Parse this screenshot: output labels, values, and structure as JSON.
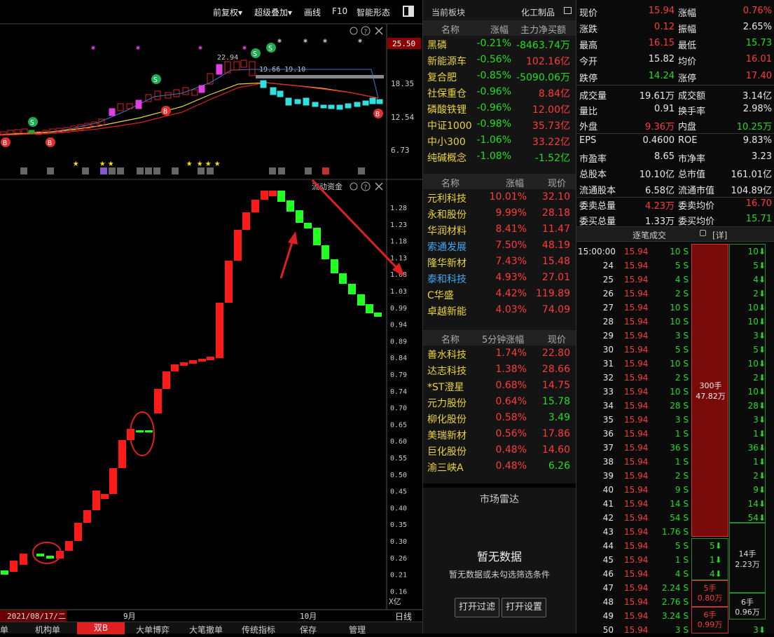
{
  "toolbar": {
    "items": [
      "前复权▾",
      "超级叠加▾",
      "画线",
      "F10",
      "智能形态"
    ]
  },
  "kline": {
    "price_badge": "25.50",
    "y_ticks": [
      "18.35",
      "12.54",
      "6.73"
    ],
    "annotation_high": "22.94",
    "annotation_range": "19.66-19.10"
  },
  "flow": {
    "title": "流动资金",
    "y_ticks": [
      "1.28",
      "1.23",
      "1.18",
      "1.13",
      "1.08",
      "1.03",
      "0.99",
      "0.94",
      "0.89",
      "0.84",
      "0.79",
      "0.74",
      "0.70",
      "0.65",
      "0.60",
      "0.55",
      "0.50",
      "0.45",
      "0.40",
      "0.35",
      "0.30",
      "0.26",
      "0.21",
      "0.16"
    ],
    "unit": "X亿"
  },
  "x_axis": {
    "date": "2021/08/17/二",
    "m1": "9月",
    "m2": "10月",
    "right": "日线"
  },
  "bottom_tabs": [
    "单",
    "机构单",
    "双B",
    "大单博弈",
    "大笔撤单",
    "传统指标",
    "保存",
    "管理"
  ],
  "sector": {
    "header_left": "当前板块",
    "header_right": "化工制品",
    "cols": [
      "名称",
      "涨幅",
      "主力净买额"
    ],
    "rows": [
      {
        "name": "黑磷",
        "pct": "-0.21%",
        "val": "-8463.74万"
      },
      {
        "name": "新能源车",
        "pct": "-0.56%",
        "val": "102.16亿"
      },
      {
        "name": "复合肥",
        "pct": "-0.85%",
        "val": "-5090.06万"
      },
      {
        "name": "社保重仓",
        "pct": "-0.96%",
        "val": "8.84亿"
      },
      {
        "name": "磷酸铁锂",
        "pct": "-0.96%",
        "val": "12.00亿"
      },
      {
        "name": "中证1000",
        "pct": "-0.98%",
        "val": "35.73亿"
      },
      {
        "name": "中小300",
        "pct": "-1.06%",
        "val": "33.22亿"
      },
      {
        "name": "纯碱概念",
        "pct": "-1.08%",
        "val": "-1.52亿"
      }
    ]
  },
  "related": {
    "cols": [
      "名称",
      "涨幅",
      "现价"
    ],
    "rows": [
      {
        "name": "元利科技",
        "pct": "10.01%",
        "price": "32.10"
      },
      {
        "name": "永和股份",
        "pct": "9.99%",
        "price": "28.18"
      },
      {
        "name": "华润材料",
        "pct": "8.41%",
        "price": "11.47"
      },
      {
        "name": "索通发展",
        "pct": "7.50%",
        "price": "48.19"
      },
      {
        "name": "隆华新材",
        "pct": "7.43%",
        "price": "15.48"
      },
      {
        "name": "泰和科技",
        "pct": "4.93%",
        "price": "27.01"
      },
      {
        "name": "C华盛",
        "pct": "4.42%",
        "price": "119.89"
      },
      {
        "name": "卓越新能",
        "pct": "4.03%",
        "price": "74.09"
      }
    ]
  },
  "speed": {
    "cols": [
      "名称",
      "5分钟涨幅",
      "现价"
    ],
    "rows": [
      {
        "name": "善水科技",
        "pct": "1.74%",
        "price": "22.80"
      },
      {
        "name": "达志科技",
        "pct": "1.38%",
        "price": "28.66"
      },
      {
        "name": "*ST澄星",
        "pct": "0.68%",
        "price": "14.75"
      },
      {
        "name": "元力股份",
        "pct": "0.64%",
        "price": "15.78"
      },
      {
        "name": "柳化股份",
        "pct": "0.58%",
        "price": "3.49"
      },
      {
        "name": "美瑞新材",
        "pct": "0.56%",
        "price": "17.86"
      },
      {
        "name": "巨化股份",
        "pct": "0.48%",
        "price": "14.60"
      },
      {
        "name": "渝三峡A",
        "pct": "0.48%",
        "price": "6.26"
      }
    ]
  },
  "radar": {
    "title": "市场雷达",
    "empty": "暂无数据",
    "hint": "暂无数据或未勾选筛选条件",
    "btn_filter": "打开过滤",
    "btn_settings": "打开设置"
  },
  "quote": {
    "rows": [
      [
        "现价",
        "15.94",
        "涨幅",
        "0.76%"
      ],
      [
        "涨跌",
        "0.12",
        "振幅",
        "2.65%"
      ],
      [
        "最高",
        "16.15",
        "最低",
        "15.73"
      ],
      [
        "今开",
        "15.82",
        "均价",
        "16.01"
      ],
      [
        "跌停",
        "14.24",
        "涨停",
        "17.40"
      ],
      [
        "成交量",
        "19.61万",
        "成交额",
        "3.14亿"
      ],
      [
        "量比",
        "0.91",
        "换手率",
        "2.98%"
      ],
      [
        "外盘",
        "9.36万",
        "内盘",
        "10.25万"
      ],
      [
        "EPS",
        "0.4600",
        "ROE",
        "9.83%"
      ],
      [
        "市盈率",
        "8.65",
        "市净率",
        "3.23"
      ],
      [
        "总股本",
        "10.10亿",
        "总市值",
        "161.01亿"
      ],
      [
        "流通股本",
        "6.58亿",
        "流通市值",
        "104.89亿"
      ],
      [
        "委卖总量",
        "4.23万",
        "委卖均价",
        "16.70"
      ],
      [
        "委买总量",
        "1.33万",
        "委买均价",
        "15.71"
      ]
    ]
  },
  "ticks": {
    "title": "逐笔成交",
    "detail": "[详]",
    "first_time": "15:00:00",
    "rows": [
      {
        "t": "",
        "p": "15.94",
        "v": "10 S",
        "r": "10"
      },
      {
        "t": "24",
        "p": "15.94",
        "v": "5 S",
        "r": "5"
      },
      {
        "t": "25",
        "p": "15.94",
        "v": "4 S",
        "r": "4"
      },
      {
        "t": "26",
        "p": "15.94",
        "v": "2 S",
        "r": "2"
      },
      {
        "t": "27",
        "p": "15.94",
        "v": "10 S",
        "r": "10"
      },
      {
        "t": "28",
        "p": "15.94",
        "v": "10 S",
        "r": "10"
      },
      {
        "t": "29",
        "p": "15.94",
        "v": "3 S",
        "r": "3"
      },
      {
        "t": "30",
        "p": "15.94",
        "v": "5 S",
        "r": "5"
      },
      {
        "t": "31",
        "p": "15.94",
        "v": "10 S",
        "r": "10"
      },
      {
        "t": "32",
        "p": "15.94",
        "v": "2 S",
        "r": "2"
      },
      {
        "t": "33",
        "p": "15.94",
        "v": "10 S",
        "r": "10"
      },
      {
        "t": "34",
        "p": "15.94",
        "v": "28 S",
        "r": "28"
      },
      {
        "t": "35",
        "p": "15.94",
        "v": "3 S",
        "r": "3"
      },
      {
        "t": "36",
        "p": "15.94",
        "v": "1 S",
        "r": "1"
      },
      {
        "t": "37",
        "p": "15.94",
        "v": "36 S",
        "r": "36"
      },
      {
        "t": "38",
        "p": "15.94",
        "v": "1 S",
        "r": "1"
      },
      {
        "t": "39",
        "p": "15.94",
        "v": "2 S",
        "r": "2"
      },
      {
        "t": "40",
        "p": "15.94",
        "v": "9 S",
        "r": "9"
      },
      {
        "t": "41",
        "p": "15.94",
        "v": "14 S",
        "r": "14"
      },
      {
        "t": "42",
        "p": "15.94",
        "v": "54 S",
        "r": "54"
      },
      {
        "t": "43",
        "p": "15.94",
        "v": "1.76 S",
        "r": ""
      },
      {
        "t": "44",
        "p": "15.94",
        "v": "5 S",
        "r": ""
      },
      {
        "t": "45",
        "p": "15.94",
        "v": "1 S",
        "r": ""
      },
      {
        "t": "46",
        "p": "15.94",
        "v": "4 S",
        "r": ""
      },
      {
        "t": "47",
        "p": "15.94",
        "v": "2.24 S",
        "r": ""
      },
      {
        "t": "48",
        "p": "15.94",
        "v": "2.76 S",
        "r": ""
      },
      {
        "t": "49",
        "p": "15.94",
        "v": "3.24 S",
        "r": ""
      },
      {
        "t": "50",
        "p": "15.94",
        "v": "3 S",
        "r": "3"
      }
    ],
    "big_block": {
      "a": "300手",
      "b": "47.82万"
    },
    "box_14": {
      "a": "14手",
      "b": "2.23万"
    },
    "box_5": {
      "a": "5手",
      "b": "0.80万"
    },
    "box_6": {
      "a": "6手",
      "b": "0.96万"
    },
    "box_6b": {
      "a": "6手",
      "b": "0.99万"
    },
    "mini_5": "5",
    "mini_1": "1",
    "mini_4": "4"
  }
}
